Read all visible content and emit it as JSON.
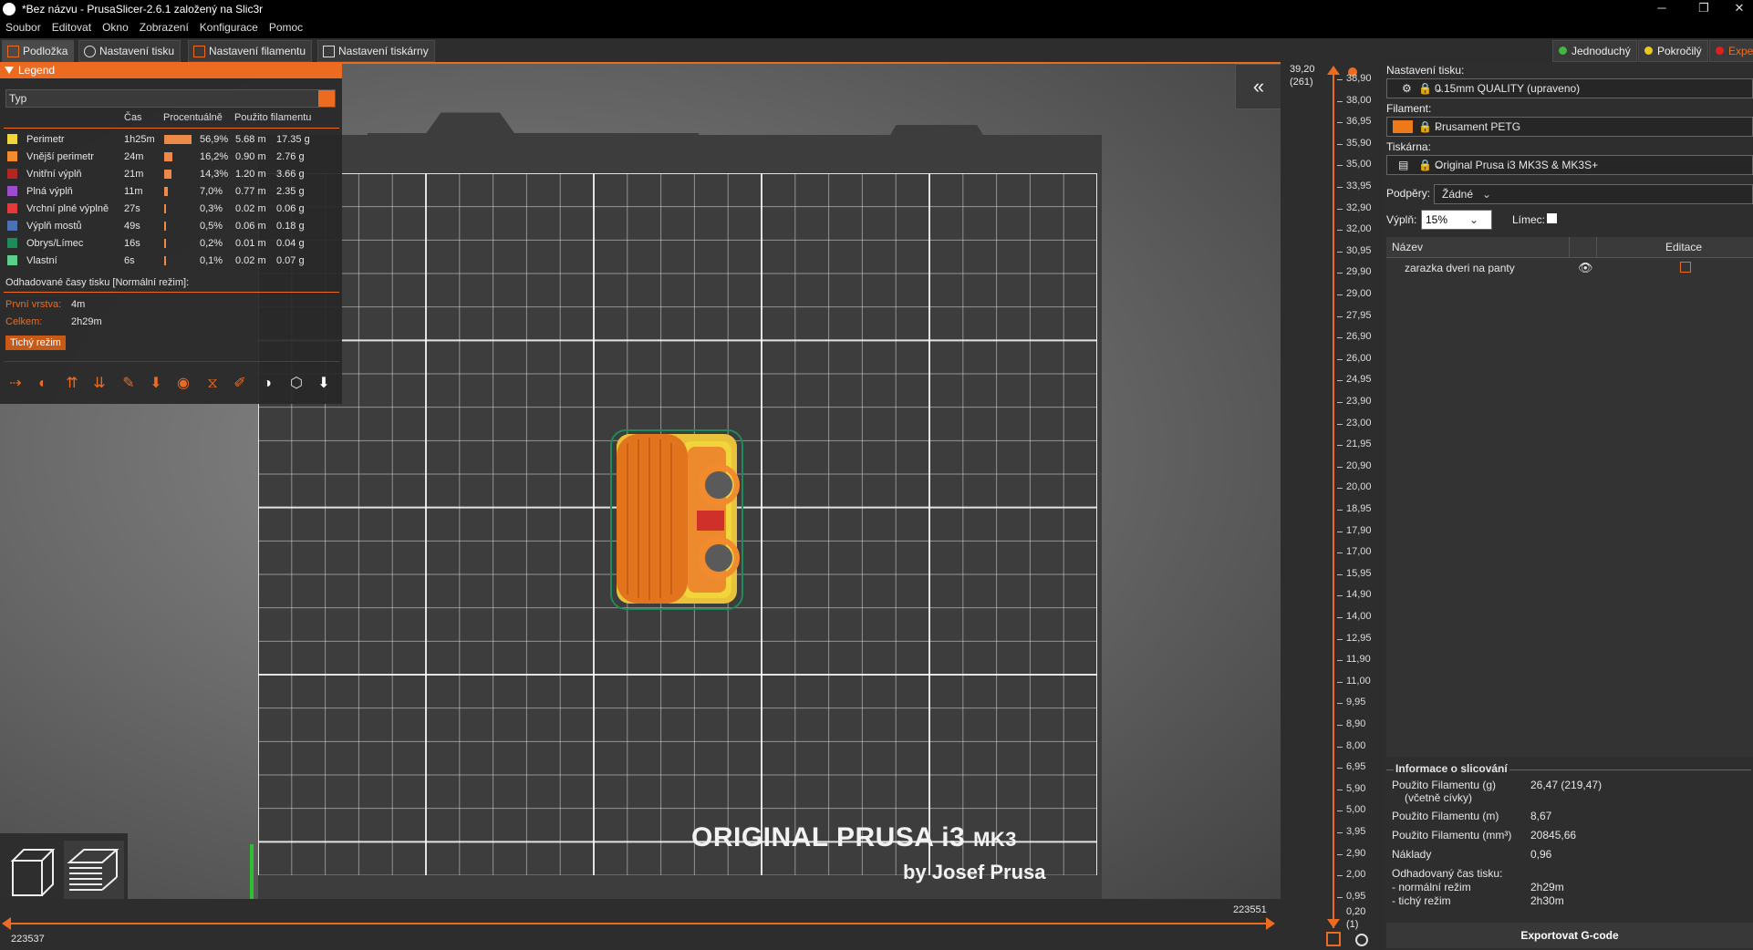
{
  "window": {
    "title": "*Bez názvu - PrusaSlicer-2.6.1 založený na Slic3r"
  },
  "menu": [
    "Soubor",
    "Editovat",
    "Okno",
    "Zobrazení",
    "Konfigurace",
    "Pomoc"
  ],
  "tabs": [
    "Podložka",
    "Nastavení tisku",
    "Nastavení filamentu",
    "Nastavení tiskárny"
  ],
  "modes": [
    "Jednoduchý",
    "Pokročilý",
    "Expe"
  ],
  "colors": {
    "accent": "#ed6b21",
    "simple": "#3fb83f",
    "advanced": "#e8c820",
    "expert": "#e02020"
  },
  "legend": {
    "title": "Legend",
    "type_select": "Typ",
    "columns": [
      "Čas",
      "Procentuálně",
      "Použito filamentu"
    ],
    "rows": [
      {
        "name": "Perimetr",
        "time": "1h25m",
        "percent": "56,9%",
        "pct_value": 56.9,
        "length": "5.68 m",
        "weight": "17.35 g",
        "color": "#f2d53a"
      },
      {
        "name": "Vnější perimetr",
        "time": "24m",
        "percent": "16,2%",
        "pct_value": 16.2,
        "length": "0.90 m",
        "weight": "2.76 g",
        "color": "#f28a2e"
      },
      {
        "name": "Vnitřní výplň",
        "time": "21m",
        "percent": "14,3%",
        "pct_value": 14.3,
        "length": "1.20 m",
        "weight": "3.66 g",
        "color": "#b32626"
      },
      {
        "name": "Plná výplň",
        "time": "11m",
        "percent": "7,0%",
        "pct_value": 7.0,
        "length": "0.77 m",
        "weight": "2.35 g",
        "color": "#9a4dcc"
      },
      {
        "name": "Vrchní plné výplně",
        "time": "27s",
        "percent": "0,3%",
        "pct_value": 0.3,
        "length": "0.02 m",
        "weight": "0.06 g",
        "color": "#e63a3a"
      },
      {
        "name": "Výplň mostů",
        "time": "49s",
        "percent": "0,5%",
        "pct_value": 0.5,
        "length": "0.06 m",
        "weight": "0.18 g",
        "color": "#4d72b3"
      },
      {
        "name": "Obrys/Límec",
        "time": "16s",
        "percent": "0,2%",
        "pct_value": 0.2,
        "length": "0.01 m",
        "weight": "0.04 g",
        "color": "#1f8a5a"
      },
      {
        "name": "Vlastní",
        "time": "6s",
        "percent": "0,1%",
        "pct_value": 0.1,
        "length": "0.02 m",
        "weight": "0.07 g",
        "color": "#5ecf8a"
      }
    ],
    "estimated_title": "Odhadované časy tisku [Normální režim]:",
    "first_layer_label": "První vrstva:",
    "first_layer_value": "4m",
    "total_label": "Celkem:",
    "total_value": "2h29m",
    "quiet_button": "Tichý režim"
  },
  "bed": {
    "brand_line1": "ORIGINAL PRUSA i3",
    "brand_model": "MK3",
    "brand_line2": "by Josef Prusa"
  },
  "vertical_slider": {
    "top_value": "39,20",
    "top_layer": "(261)",
    "bottom_value": "0,20",
    "bottom_layer": "(1)",
    "ticks": [
      "38,90",
      "38,00",
      "36,95",
      "35,90",
      "35,00",
      "33,95",
      "32,90",
      "32,00",
      "30,95",
      "29,90",
      "29,00",
      "27,95",
      "26,90",
      "26,00",
      "24,95",
      "23,90",
      "23,00",
      "21,95",
      "20,90",
      "20,00",
      "18,95",
      "17,90",
      "17,00",
      "15,95",
      "14,90",
      "14,00",
      "12,95",
      "11,90",
      "11,00",
      "9,95",
      "8,90",
      "8,00",
      "6,95",
      "5,90",
      "5,00",
      "3,95",
      "2,90",
      "2,00",
      "0,95"
    ]
  },
  "horizontal_slider": {
    "left_value": "223537",
    "right_value": "223551"
  },
  "right": {
    "print_settings_label": "Nastavení tisku:",
    "print_settings_value": "0.15mm QUALITY (upraveno)",
    "filament_label": "Filament:",
    "filament_value": "Prusament PETG",
    "printer_label": "Tiskárna:",
    "printer_value": "Original Prusa i3 MK3S & MK3S+",
    "supports_label": "Podpěry:",
    "supports_value": "Žádné",
    "infill_label": "Výplň:",
    "infill_value": "15%",
    "brim_label": "Límec:",
    "list_col_name": "Název",
    "list_col_edit": "Editace",
    "object_name": "zarazka dveri na panty",
    "info_title": "Informace o slicování",
    "info": [
      {
        "label": "Použito Filamentu (g)",
        "sub": "(včetně cívky)",
        "value": "26,47 (219,47)"
      },
      {
        "label": "Použito Filamentu (m)",
        "value": "8,67"
      },
      {
        "label": "Použito Filamentu (mm³)",
        "value": "20845,66"
      },
      {
        "label": "Náklady",
        "value": "0,96"
      },
      {
        "label": "Odhadovaný čas tisku:",
        "value": ""
      },
      {
        "label": "- normální režim",
        "value": "2h29m"
      },
      {
        "label": "- tichý režim",
        "value": "2h30m"
      }
    ],
    "export_button": "Exportovat G-code"
  }
}
